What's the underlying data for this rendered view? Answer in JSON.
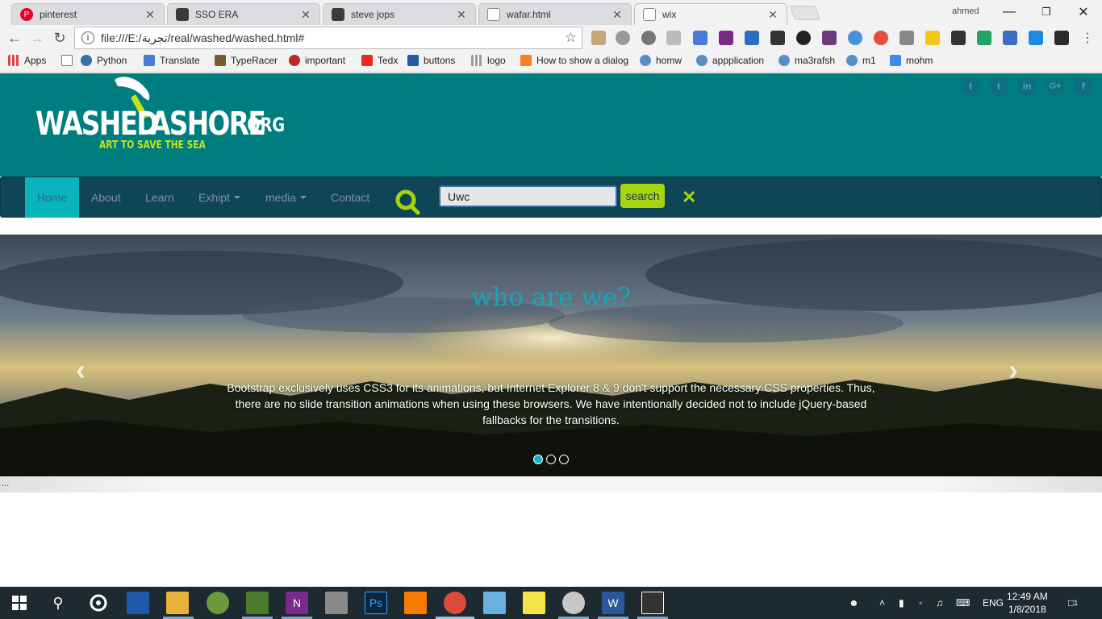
{
  "browser": {
    "tabs": [
      {
        "title": "pinterest",
        "icon": "pinterest-icon",
        "color": "#e60023"
      },
      {
        "title": "SSO ERA",
        "icon": "sso-icon",
        "color": "#3b3b3b"
      },
      {
        "title": "steve jops",
        "icon": "steve-icon",
        "color": "#3b3b3b"
      },
      {
        "title": "wafar.html",
        "icon": "file-icon",
        "color": "#888888"
      },
      {
        "title": "wix",
        "icon": "file-icon",
        "color": "#888888"
      }
    ],
    "user": "ahmed",
    "url": "file:///E:/تجربة/real/washed/washed.html#",
    "bookmarks": [
      {
        "label": "Apps",
        "icon": "apps-grid-icon"
      },
      {
        "label": "",
        "icon": "page-icon"
      },
      {
        "label": "Python",
        "icon": "python-icon"
      },
      {
        "label": "Translate",
        "icon": "translate-icon"
      },
      {
        "label": "TypeRacer",
        "icon": "typeracer-icon"
      },
      {
        "label": "important",
        "icon": "quora-icon"
      },
      {
        "label": "Tedx",
        "icon": "tedx-icon"
      },
      {
        "label": "buttons",
        "icon": "buttons-icon"
      },
      {
        "label": "logo",
        "icon": "logo-grid-icon"
      },
      {
        "label": "How to show a dialog",
        "icon": "stackoverflow-icon"
      },
      {
        "label": "homw",
        "icon": "uwc-icon"
      },
      {
        "label": "appplication",
        "icon": "uwc-icon"
      },
      {
        "label": "ma3rafsh",
        "icon": "uwc-icon"
      },
      {
        "label": "m1",
        "icon": "uwc-icon"
      },
      {
        "label": "mohm",
        "icon": "doc-icon"
      }
    ]
  },
  "site": {
    "logo": {
      "word": "WASHED",
      "word2": "ASHORE",
      "org": ".ORG",
      "tagline": "ART TO SAVE THE SEA"
    },
    "social": [
      "t",
      "t",
      "in",
      "G+",
      "f"
    ],
    "nav": [
      {
        "label": "Home",
        "active": true
      },
      {
        "label": "About"
      },
      {
        "label": "Learn"
      },
      {
        "label": "Exhipt",
        "dropdown": true
      },
      {
        "label": "media",
        "dropdown": true
      },
      {
        "label": "Contact"
      }
    ],
    "search": {
      "value": "Uwc",
      "button": "search",
      "close": "✕"
    },
    "carousel": {
      "heading": "who are we?",
      "text": "Bootstrap exclusively uses CSS3 for its animations, but Internet Explorer 8 & 9 don't support the necessary CSS properties. Thus, there are no slide transition animations when using these browsers. We have intentionally decided not to include jQuery-based fallbacks for the transitions.",
      "prev": "‹",
      "next": "›",
      "slides_count": 3,
      "active_slide": 1
    },
    "ellipsis": "..."
  },
  "taskbar": {
    "lang": "ENG",
    "time": "12:49 AM",
    "date": "1/8/2018",
    "notifications": "1"
  },
  "colors": {
    "header": "#007e7f",
    "navbar": "#0f4657",
    "accent": "#a9d20f",
    "nav_active": "#09b4bd",
    "heading": "#16a5b9"
  }
}
